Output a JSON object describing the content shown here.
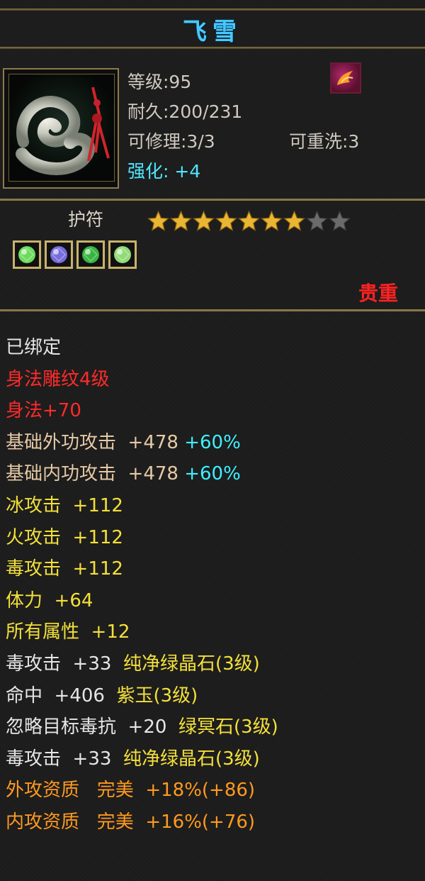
{
  "item": {
    "name": "飞雪",
    "level": "等级:95",
    "durability": "耐久:200/231",
    "repairable": "可修理:3/3",
    "rewashable": "可重洗:3",
    "enhance_label": "强化:",
    "enhance_value": "+4",
    "type": "护符",
    "stars": {
      "filled": 7,
      "total": 9
    },
    "rarity": "贵重",
    "icon": "jade-amulet-icon",
    "badge_icon": "phoenix-emblem-icon"
  },
  "gems": [
    {
      "icon": "green-crystal-gem-icon",
      "color": "#7dff6a"
    },
    {
      "icon": "purple-jade-gem-icon",
      "color": "#8a7dff"
    },
    {
      "icon": "green-dark-stone-gem-icon",
      "color": "#3fd24a"
    },
    {
      "icon": "green-crystal-gem-icon",
      "color": "#a8ff8a"
    }
  ],
  "attributes": [
    {
      "parts": [
        {
          "text": "已绑定",
          "color": "white"
        }
      ]
    },
    {
      "parts": [
        {
          "text": "身法雕纹4级",
          "color": "red"
        }
      ]
    },
    {
      "parts": [
        {
          "text": "身法+70",
          "color": "red"
        }
      ]
    },
    {
      "parts": [
        {
          "text": "基础外功攻击  +478 ",
          "color": "tan"
        },
        {
          "text": "+60%",
          "color": "cyan"
        }
      ]
    },
    {
      "parts": [
        {
          "text": "基础内功攻击  +478 ",
          "color": "tan"
        },
        {
          "text": "+60%",
          "color": "cyan"
        }
      ]
    },
    {
      "parts": [
        {
          "text": "冰攻击  +112",
          "color": "yellow"
        }
      ]
    },
    {
      "parts": [
        {
          "text": "火攻击  +112",
          "color": "yellow"
        }
      ]
    },
    {
      "parts": [
        {
          "text": "毒攻击  +112",
          "color": "yellow"
        }
      ]
    },
    {
      "parts": [
        {
          "text": "体力  +64",
          "color": "yellow"
        }
      ]
    },
    {
      "parts": [
        {
          "text": "所有属性  +12",
          "color": "yellow"
        }
      ]
    },
    {
      "parts": [
        {
          "text": "毒攻击  +33  ",
          "color": "white"
        },
        {
          "text": "纯净绿晶石(3级)",
          "color": "yellow"
        }
      ]
    },
    {
      "parts": [
        {
          "text": "命中  +406  ",
          "color": "white"
        },
        {
          "text": "紫玉(3级)",
          "color": "yellow"
        }
      ]
    },
    {
      "parts": [
        {
          "text": "忽略目标毒抗  +20  ",
          "color": "white"
        },
        {
          "text": "绿冥石(3级)",
          "color": "yellow"
        }
      ]
    },
    {
      "parts": [
        {
          "text": "毒攻击  +33  ",
          "color": "white"
        },
        {
          "text": "纯净绿晶石(3级)",
          "color": "yellow"
        }
      ]
    },
    {
      "parts": [
        {
          "text": "外攻资质   完美  +18%(+86)",
          "color": "orange"
        }
      ]
    },
    {
      "parts": [
        {
          "text": "内攻资质   完美  +16%(+76)",
          "color": "orange"
        }
      ]
    }
  ],
  "colors": {
    "white": "#e6e6e6",
    "red": "#ff2a2a",
    "tan": "#e6c9a6",
    "cyan": "#3ef0ff",
    "yellow": "#f3e03a",
    "orange": "#ff9a1e",
    "frame_gold": "#8a7748",
    "title_blue": "#48c8ff"
  }
}
